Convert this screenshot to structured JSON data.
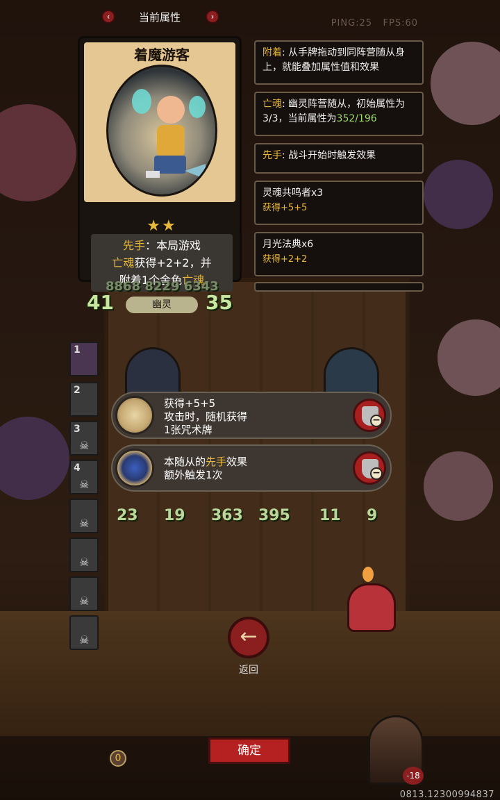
{
  "header": {
    "title": "当前属性",
    "prev_icon": "chevron-left-icon",
    "next_icon": "chevron-right-icon"
  },
  "overlay": {
    "ping": "PING:25",
    "fps": "FPS:60",
    "device_id": "0813.12300994837"
  },
  "card": {
    "name": "着魔游客",
    "stars": "★★",
    "star_count": 2,
    "desc_kw1": "先手",
    "desc_line1_rest": "：本局游戏",
    "desc_kw2": "亡魂",
    "desc_line2_rest": "获得+2+2，并",
    "desc_line3_start": "附着1个金色",
    "desc_kw3": "亡魂",
    "attack": "41",
    "health": "35",
    "tribe": "幽灵"
  },
  "panels": [
    {
      "kw": "附着",
      "text": ": 从手牌拖动到同阵营随从身上，就能叠加属性值和效果"
    },
    {
      "kw": "亡魂",
      "text": ": 幽灵阵营随从，初始属性为3/3，当前属性为",
      "value": "352/196"
    },
    {
      "kw": "先手",
      "text": ": 战斗开始时触发效果"
    },
    {
      "title": "灵魂共鸣者x3",
      "sub": "获得+5+5"
    },
    {
      "title": "月光法典x6",
      "sub": "获得+2+2"
    }
  ],
  "board_top_stats": {
    "values": "8868 8229   6343"
  },
  "slots": [
    {
      "num": "1"
    },
    {
      "num": "2"
    },
    {
      "num": "3"
    },
    {
      "num": "4"
    },
    {
      "num": ""
    },
    {
      "num": ""
    },
    {
      "num": ""
    },
    {
      "num": ""
    }
  ],
  "effects": [
    {
      "line1": "获得+5+5",
      "line2": "攻击时，随机获得",
      "line3": "1张咒术牌"
    },
    {
      "line1_pre": "本随从的",
      "line1_kw": "先手",
      "line1_post": "效果",
      "line2": "额外触发1次"
    }
  ],
  "board_stats": [
    {
      "atk": "23",
      "hp": "19"
    },
    {
      "atk": "363",
      "hp": "395"
    },
    {
      "atk": "11",
      "hp": "9"
    }
  ],
  "back_label": "返回",
  "confirm_label": "确定",
  "gold": "0",
  "hero_hp": "-18",
  "colors": {
    "accent_gold": "#e7b83a",
    "button_red": "#b52020",
    "stat_green": "#c8e6a0"
  }
}
